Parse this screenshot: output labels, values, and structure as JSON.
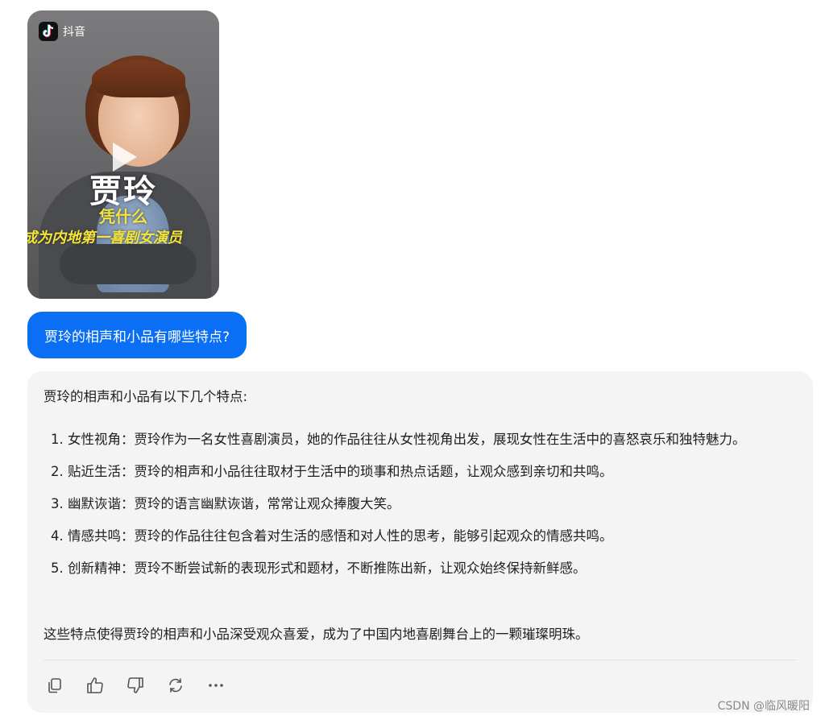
{
  "video": {
    "platform_label": "抖音",
    "title": "贾玲",
    "subtitle": "凭什么",
    "subtitle2": "成为内地第一喜剧女演员"
  },
  "user_message": {
    "text": "贾玲的相声和小品有哪些特点?"
  },
  "reply": {
    "intro": "贾玲的相声和小品有以下几个特点:",
    "points": [
      {
        "num": "1.",
        "text": "女性视角：贾玲作为一名女性喜剧演员，她的作品往往从女性视角出发，展现女性在生活中的喜怒哀乐和独特魅力。"
      },
      {
        "num": "2.",
        "text": "贴近生活：贾玲的相声和小品往往取材于生活中的琐事和热点话题，让观众感到亲切和共鸣。"
      },
      {
        "num": "3.",
        "text": "幽默诙谐：贾玲的语言幽默诙谐，常常让观众捧腹大笑。"
      },
      {
        "num": "4.",
        "text": "情感共鸣：贾玲的作品往往包含着对生活的感悟和对人性的思考，能够引起观众的情感共鸣。"
      },
      {
        "num": "5.",
        "text": "创新精神：贾玲不断尝试新的表现形式和题材，不断推陈出新，让观众始终保持新鲜感。"
      }
    ],
    "outro": "这些特点使得贾玲的相声和小品深受观众喜爱，成为了中国内地喜剧舞台上的一颗璀璨明珠。"
  },
  "actions": [
    {
      "name": "copy-icon"
    },
    {
      "name": "thumbs-up-icon"
    },
    {
      "name": "thumbs-down-icon"
    },
    {
      "name": "regenerate-icon"
    },
    {
      "name": "more-icon"
    }
  ],
  "watermark": "CSDN @临风暖阳",
  "colors": {
    "user_bubble": "#0a6ff4",
    "reply_bg": "#f4f4f5",
    "overlay_yellow": "#f5e43a"
  }
}
